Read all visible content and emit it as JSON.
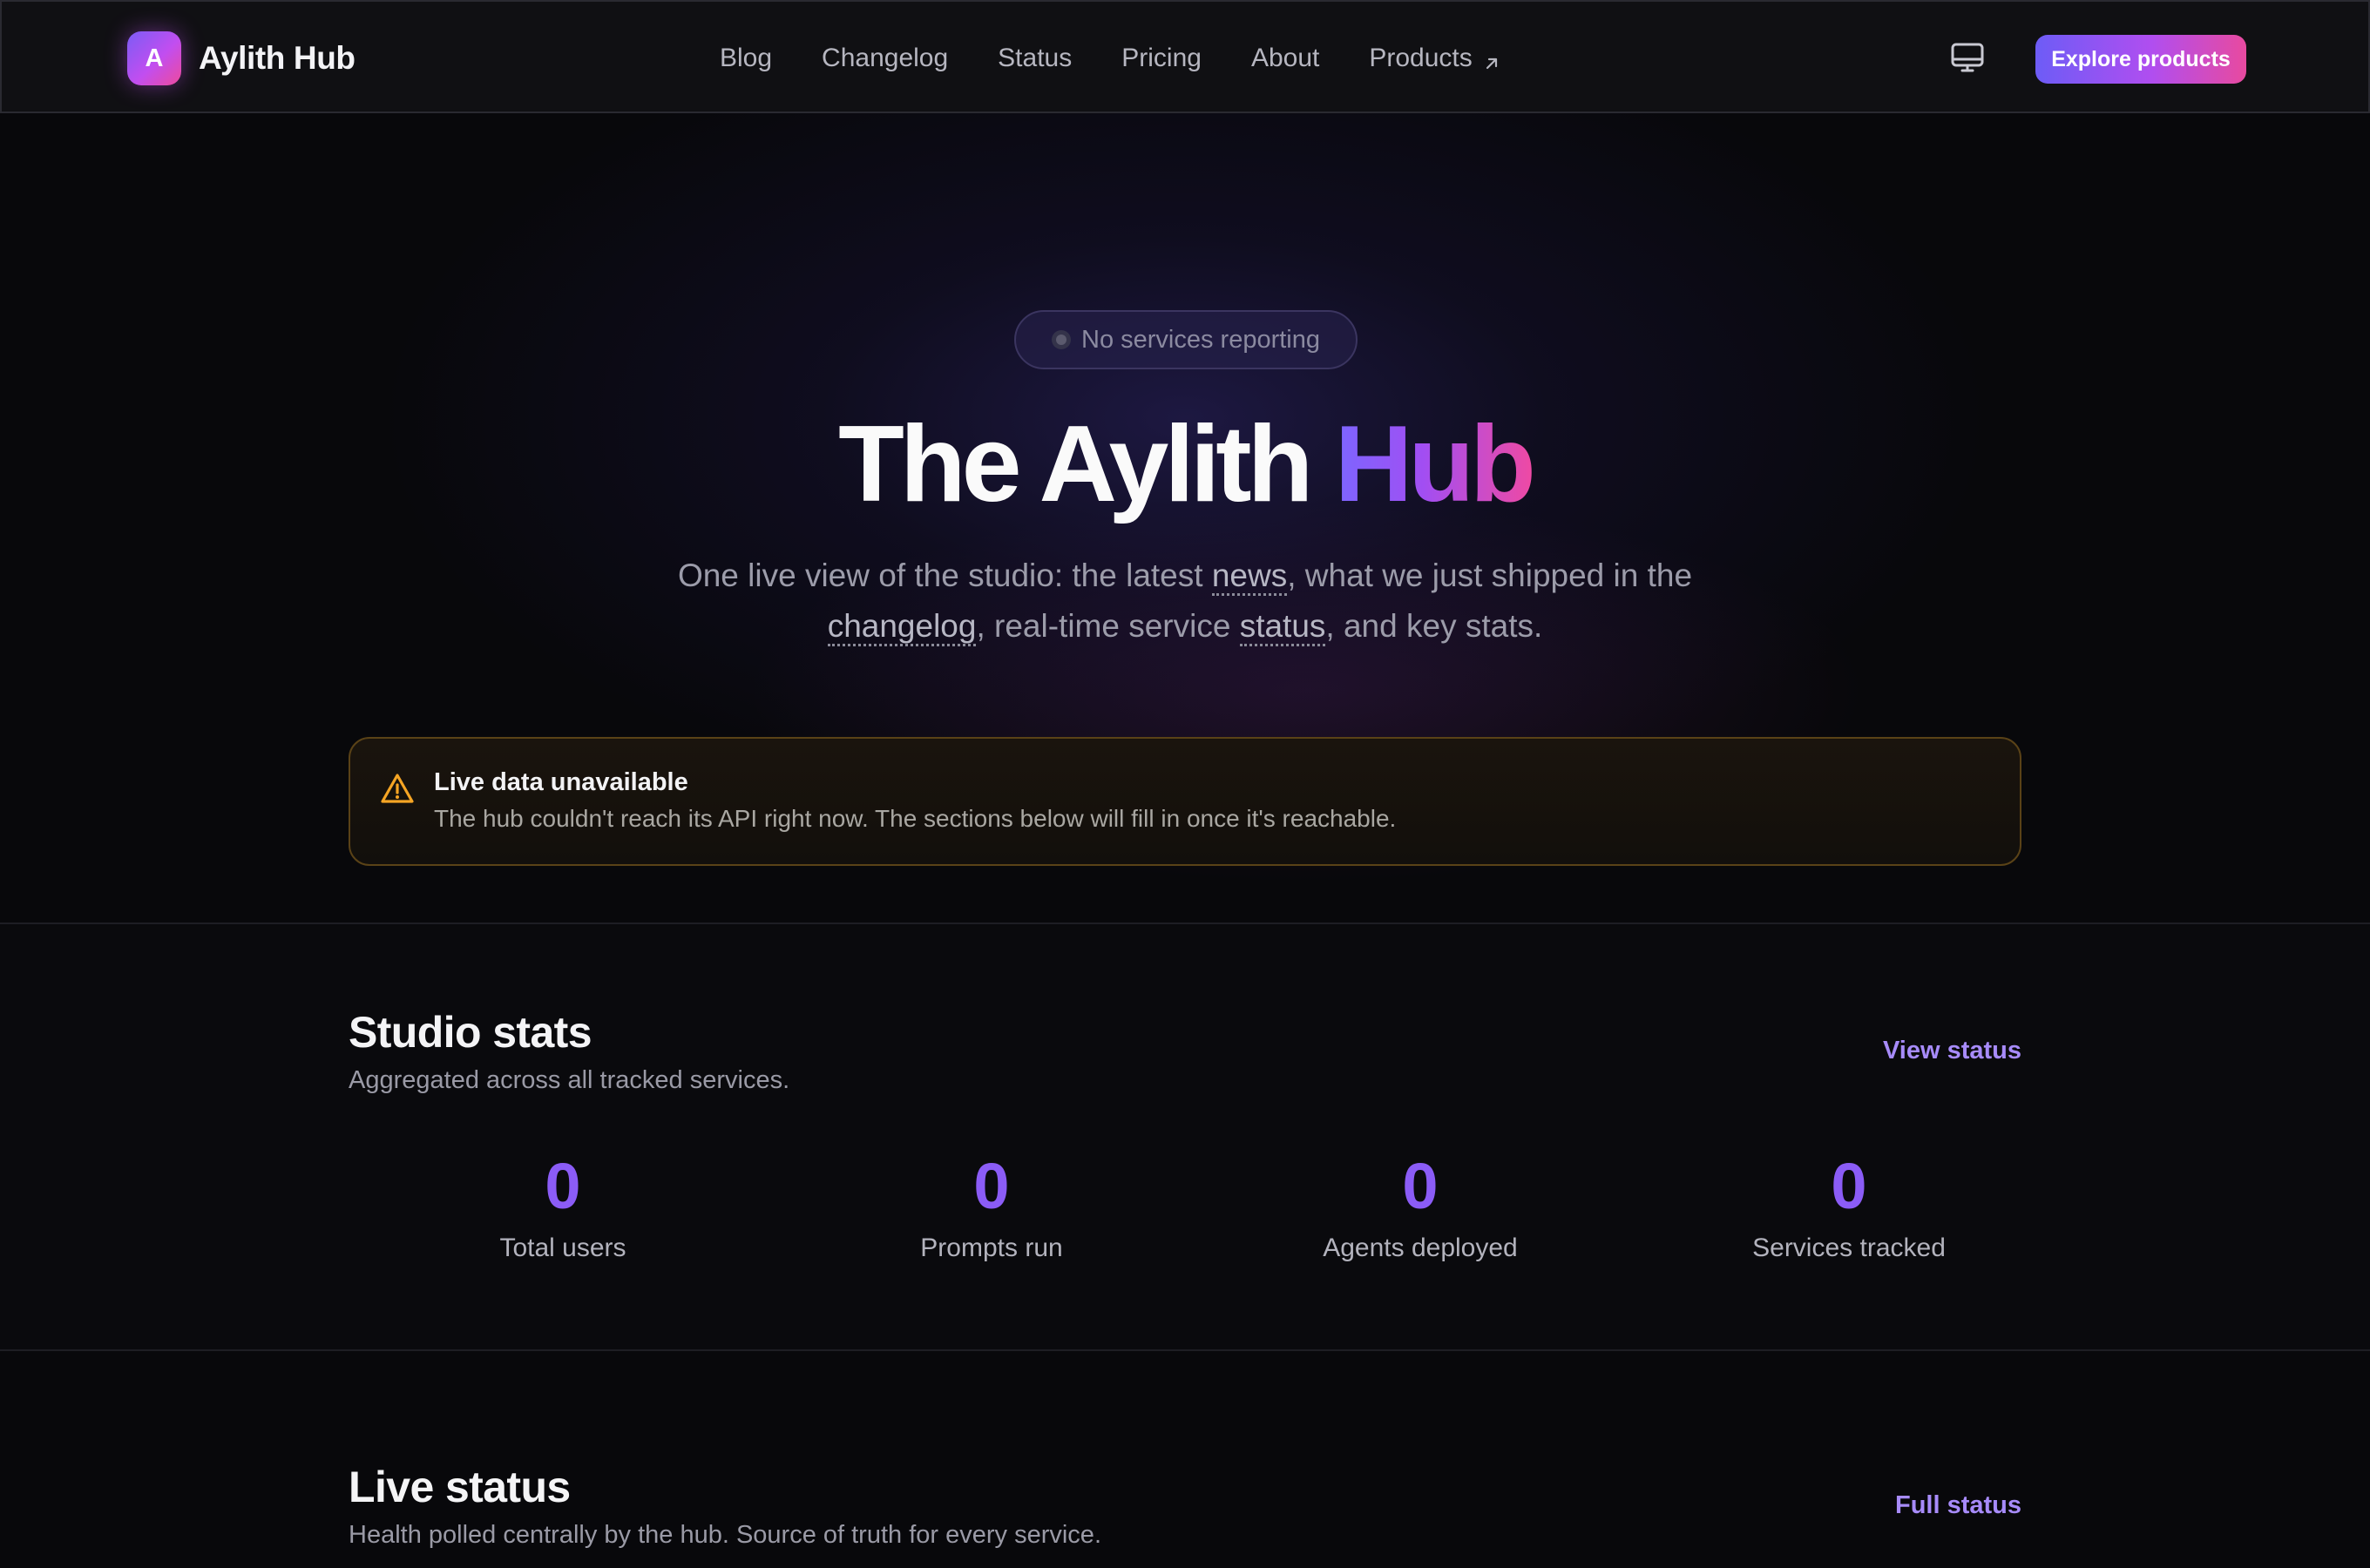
{
  "brand": {
    "mark": "A",
    "name": "Aylith Hub"
  },
  "nav": {
    "items": [
      {
        "label": "Blog"
      },
      {
        "label": "Changelog"
      },
      {
        "label": "Status"
      },
      {
        "label": "Pricing"
      },
      {
        "label": "About"
      },
      {
        "label": "Products",
        "external": true
      }
    ]
  },
  "header": {
    "cta_label": "Explore products",
    "device_icon": "monitor-icon"
  },
  "hero": {
    "pill": "No services reporting",
    "title_main": "The Aylith ",
    "title_accent": "Hub",
    "subtitle": {
      "part1": "One live view of the studio: the latest ",
      "link_news": "news",
      "part2": ", what we just shipped in the",
      "link_changelog": "changelog",
      "part3": ", real-time service ",
      "link_status": "status",
      "part4": ", and key stats."
    }
  },
  "alert": {
    "icon": "warning-icon",
    "title": "Live data unavailable",
    "text": "The hub couldn't reach its API right now. The sections below will fill in once it's reachable."
  },
  "stats": {
    "title": "Studio stats",
    "subtitle": "Aggregated across all tracked services.",
    "link": "View status",
    "items": [
      {
        "value": "0",
        "label": "Total users"
      },
      {
        "value": "0",
        "label": "Prompts run"
      },
      {
        "value": "0",
        "label": "Agents deployed"
      },
      {
        "value": "0",
        "label": "Services tracked"
      }
    ]
  },
  "live_status": {
    "title": "Live status",
    "subtitle": "Health polled centrally by the hub. Source of truth for every service.",
    "link": "Full status"
  },
  "colors": {
    "accent": "#8b5cf6",
    "link": "#a78bfa",
    "warning": "#f59e0b",
    "background": "#08080b"
  }
}
